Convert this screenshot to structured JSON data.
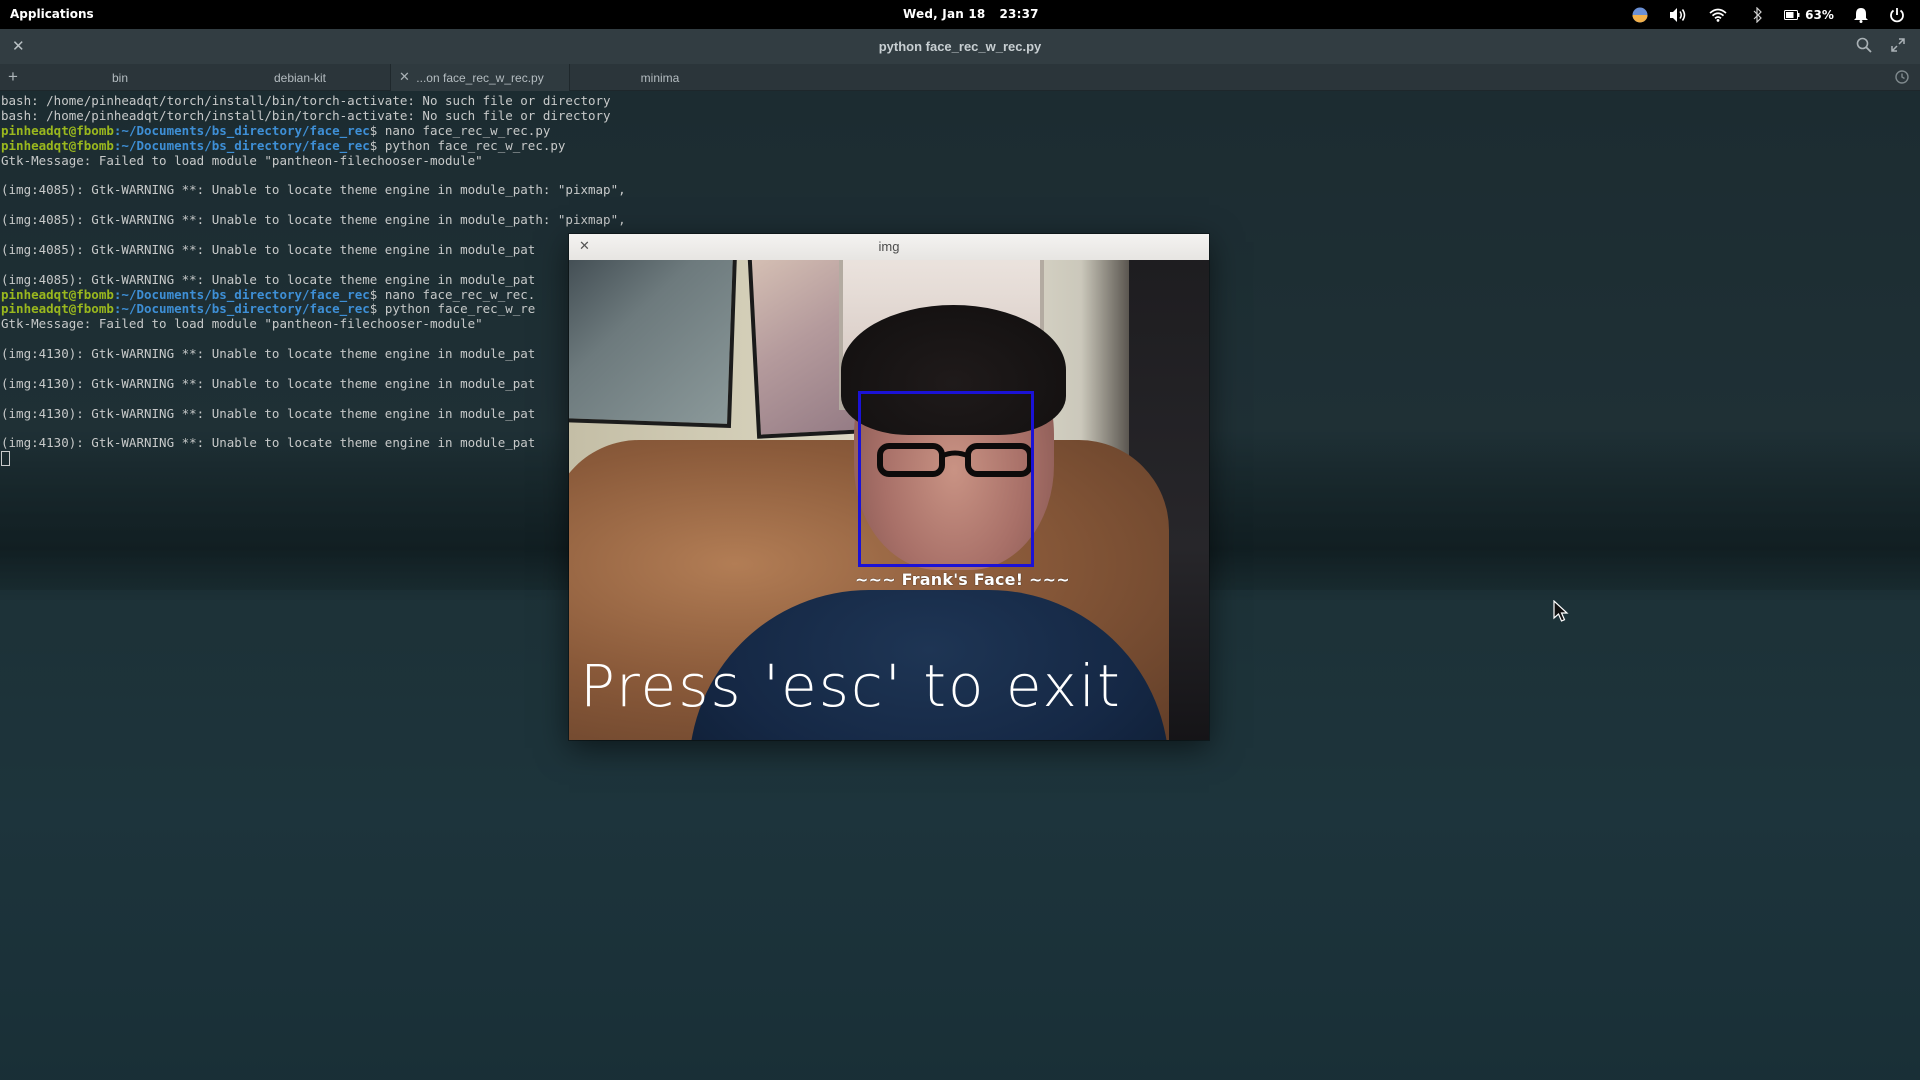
{
  "panel": {
    "applications": "Applications",
    "date": "Wed, Jan 18",
    "time": "23:37",
    "battery": "63%",
    "tray_icons": [
      "night-light-icon",
      "volume-icon",
      "wifi-icon",
      "bluetooth-icon",
      "battery-icon",
      "notifications-icon",
      "power-icon"
    ]
  },
  "terminal": {
    "window_title": "python face_rec_w_rec.py",
    "tabs": [
      {
        "label": "bin",
        "active": false
      },
      {
        "label": "debian-kit",
        "active": false
      },
      {
        "label": "...on face_rec_w_rec.py",
        "active": true
      },
      {
        "label": "minima",
        "active": false
      }
    ],
    "lines": [
      {
        "type": "text",
        "text": "bash: /home/pinheadqt/torch/install/bin/torch-activate: No such file or directory"
      },
      {
        "type": "text",
        "text": "bash: /home/pinheadqt/torch/install/bin/torch-activate: No such file or directory"
      },
      {
        "type": "prompt",
        "user": "pinheadqt@fbomb",
        "path": ":~/Documents/bs_directory/face_rec",
        "cmd": "$ nano face_rec_w_rec.py"
      },
      {
        "type": "prompt",
        "user": "pinheadqt@fbomb",
        "path": ":~/Documents/bs_directory/face_rec",
        "cmd": "$ python face_rec_w_rec.py"
      },
      {
        "type": "text",
        "text": "Gtk-Message: Failed to load module \"pantheon-filechooser-module\""
      },
      {
        "type": "text",
        "text": ""
      },
      {
        "type": "text",
        "text": "(img:4085): Gtk-WARNING **: Unable to locate theme engine in module_path: \"pixmap\","
      },
      {
        "type": "text",
        "text": ""
      },
      {
        "type": "text",
        "text": "(img:4085): Gtk-WARNING **: Unable to locate theme engine in module_path: \"pixmap\","
      },
      {
        "type": "text",
        "text": ""
      },
      {
        "type": "text",
        "text": "(img:4085): Gtk-WARNING **: Unable to locate theme engine in module_pat"
      },
      {
        "type": "text",
        "text": ""
      },
      {
        "type": "text",
        "text": "(img:4085): Gtk-WARNING **: Unable to locate theme engine in module_pat"
      },
      {
        "type": "prompt",
        "user": "pinheadqt@fbomb",
        "path": ":~/Documents/bs_directory/face_rec",
        "cmd": "$ nano face_rec_w_rec."
      },
      {
        "type": "prompt",
        "user": "pinheadqt@fbomb",
        "path": ":~/Documents/bs_directory/face_rec",
        "cmd": "$ python face_rec_w_re"
      },
      {
        "type": "text",
        "text": "Gtk-Message: Failed to load module \"pantheon-filechooser-module\""
      },
      {
        "type": "text",
        "text": ""
      },
      {
        "type": "text",
        "text": "(img:4130): Gtk-WARNING **: Unable to locate theme engine in module_pat"
      },
      {
        "type": "text",
        "text": ""
      },
      {
        "type": "text",
        "text": "(img:4130): Gtk-WARNING **: Unable to locate theme engine in module_pat"
      },
      {
        "type": "text",
        "text": ""
      },
      {
        "type": "text",
        "text": "(img:4130): Gtk-WARNING **: Unable to locate theme engine in module_pat"
      },
      {
        "type": "text",
        "text": ""
      },
      {
        "type": "text",
        "text": "(img:4130): Gtk-WARNING **: Unable to locate theme engine in module_pat"
      },
      {
        "type": "cursor"
      }
    ]
  },
  "img_window": {
    "title": "img",
    "face_label": "~~~ Frank's Face! ~~~",
    "exit_message": "Press 'esc' to exit",
    "box_color": "#1b12d6"
  },
  "colors": {
    "prompt_user": "#9ab81e",
    "prompt_path": "#3e8fd6",
    "panel_bg": "#000000"
  }
}
